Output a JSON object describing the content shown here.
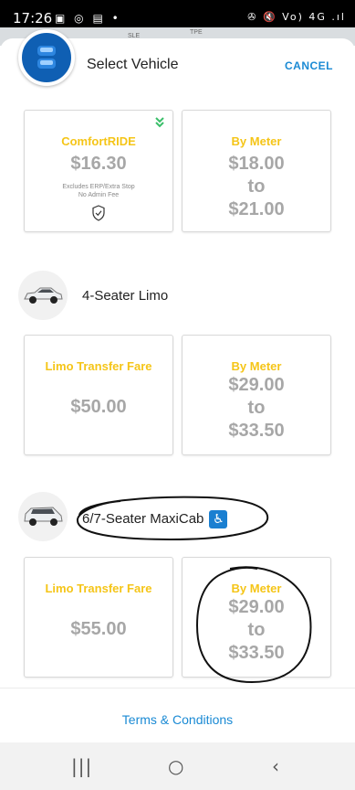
{
  "status_bar": {
    "time": "17:26",
    "left_icons": "▣ ◎ ▤ •",
    "right_icons": "✇ 🔇 Vo) 4G .ıl"
  },
  "map": {
    "road_1": "SLE",
    "road_2": "TPE"
  },
  "header": {
    "title": "Select Vehicle",
    "cancel_label": "CANCEL",
    "logo_icon": "taxi-logo-icon"
  },
  "options": [
    {
      "vehicle": "",
      "fares": [
        {
          "name": "ComfortRIDE",
          "price": "$16.30",
          "note_1": "Excludes ERP/Extra Stop",
          "note_2": "No Admin Fee"
        },
        {
          "name": "By Meter",
          "price_from": "$18.00",
          "to": "to",
          "price_to": "$21.00"
        }
      ]
    },
    {
      "vehicle": "4-Seater Limo",
      "fares": [
        {
          "name": "Limo Transfer Fare",
          "price": "$50.00"
        },
        {
          "name": "By Meter",
          "price_from": "$29.00",
          "to": "to",
          "price_to": "$33.50"
        }
      ]
    },
    {
      "vehicle": "6/7-Seater MaxiCab",
      "wheelchair_icon": "wheelchair-icon",
      "fares": [
        {
          "name": "Limo Transfer Fare",
          "price": "$55.00"
        },
        {
          "name": "By Meter",
          "price_from": "$29.00",
          "to": "to",
          "price_to": "$33.50"
        }
      ]
    }
  ],
  "footer": {
    "terms_label": "Terms & Conditions"
  },
  "nav": {
    "recents": "|||",
    "home": "○",
    "back": "‹"
  },
  "colors": {
    "accent": "#1a8ad4",
    "fare_name": "#f5c518",
    "price": "#a7a7a7",
    "logo_bg": "#0f5fb3"
  }
}
